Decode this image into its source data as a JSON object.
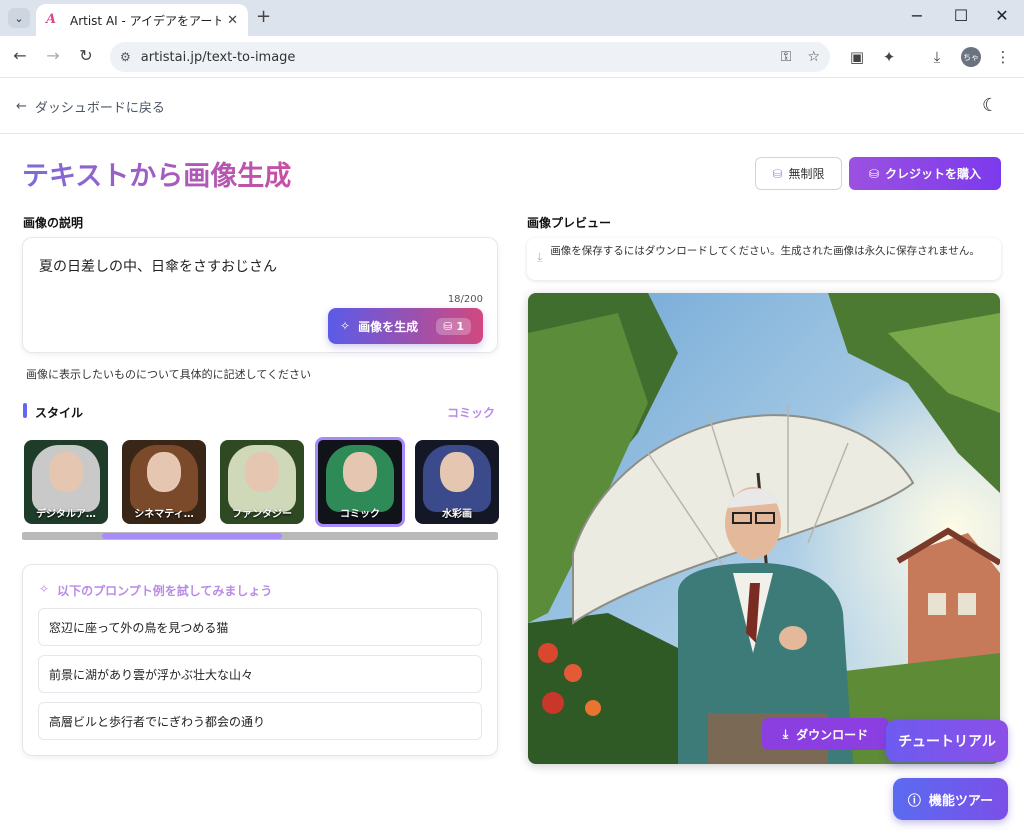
{
  "browser": {
    "tab_title": "Artist AI - アイデアをアートに変換",
    "url": "artistai.jp/text-to-image",
    "profile_initials": "ちゃ"
  },
  "header": {
    "back_label": "ダッシュボードに戻る"
  },
  "page": {
    "title": "テキストから画像生成",
    "unlimited_label": "無制限",
    "buy_credits_label": "クレジットを購入"
  },
  "prompt": {
    "section_label": "画像の説明",
    "value": "夏の日差しの中、日傘をさすおじさん",
    "char_count": "18/200",
    "generate_label": "画像を生成",
    "generate_cost": "1",
    "hint": "画像に表示したいものについて具体的に記述してください"
  },
  "style": {
    "section_label": "スタイル",
    "selected": "コミック",
    "items": [
      {
        "label": "デジタルア…",
        "hair": "#c9c9c9",
        "bg": "#1f3b2a"
      },
      {
        "label": "シネマティ…",
        "hair": "#7a4a2a",
        "bg": "#3a2616"
      },
      {
        "label": "ファンタジー",
        "hair": "#cfd8b8",
        "bg": "#2f4a22"
      },
      {
        "label": "コミック",
        "hair": "#2e8b57",
        "bg": "#101418"
      },
      {
        "label": "水彩画",
        "hair": "#3b4a8a",
        "bg": "#141826"
      }
    ],
    "scroll_position": 0.27
  },
  "examples": {
    "title": "以下のプロンプト例を試してみましょう",
    "items": [
      "窓辺に座って外の鳥を見つめる猫",
      "前景に湖があり雲が浮かぶ壮大な山々",
      "高層ビルと歩行者でにぎわう都会の通り"
    ]
  },
  "preview": {
    "section_label": "画像プレビュー",
    "notice": "画像を保存するにはダウンロードしてください。生成された画像は永久に保存されません。",
    "download_label": "ダウンロード"
  },
  "floating": {
    "tutorial_label": "チュートリアル",
    "tour_label": "機能ツアー"
  },
  "colors": {
    "accent": "#8b3fe0",
    "title_gradient_start": "#7c6bdc",
    "title_gradient_end": "#c94fa4"
  }
}
